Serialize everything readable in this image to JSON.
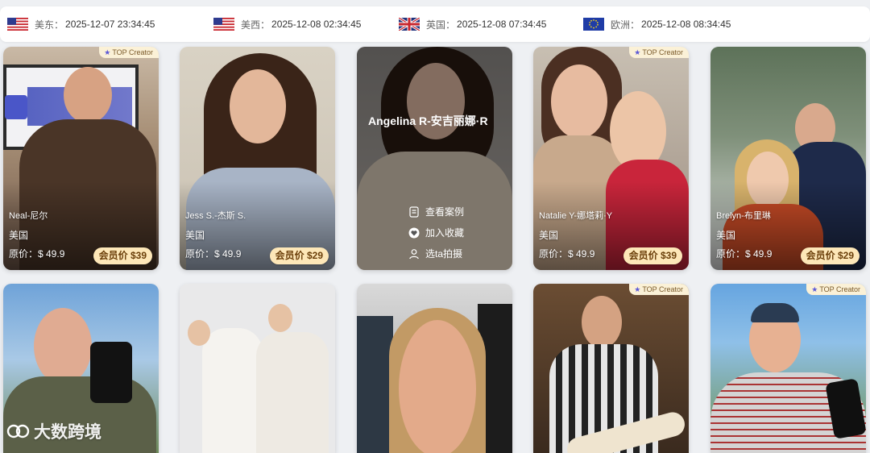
{
  "timezones": [
    {
      "flag": "us-flag-icon",
      "label": "美东：",
      "time": "2025-12-07 23:34:45"
    },
    {
      "flag": "us-flag-icon",
      "label": "美西：",
      "time": "2025-12-08 02:34:45"
    },
    {
      "flag": "uk-flag-icon",
      "label": "英国：",
      "time": "2025-12-08 07:34:45"
    },
    {
      "flag": "eu-flag-icon",
      "label": "欧洲：",
      "time": "2025-12-08 08:34:45"
    }
  ],
  "badges": {
    "top_creator": "TOP Creator"
  },
  "cards": [
    {
      "name": "Neal-尼尔",
      "country": "美国",
      "original": "原价：$ 49.9",
      "member": "会员价 $39"
    },
    {
      "name": "Jess S.-杰斯 S.",
      "country": "美国",
      "original": "原价：$ 49.9",
      "member": "会员价 $29"
    },
    {
      "name": "Angelina R-安吉丽娜·R",
      "actions": [
        "查看案例",
        "加入收藏",
        "选ta拍摄"
      ]
    },
    {
      "name": "Natalie Y-娜塔莉·Y",
      "country": "美国",
      "original": "原价：$ 49.9",
      "member": "会员价 $39"
    },
    {
      "name": "Brelyn-布里琳",
      "country": "美国",
      "original": "原价：$ 49.9",
      "member": "会员价 $29"
    }
  ],
  "watermark": "大数跨境"
}
